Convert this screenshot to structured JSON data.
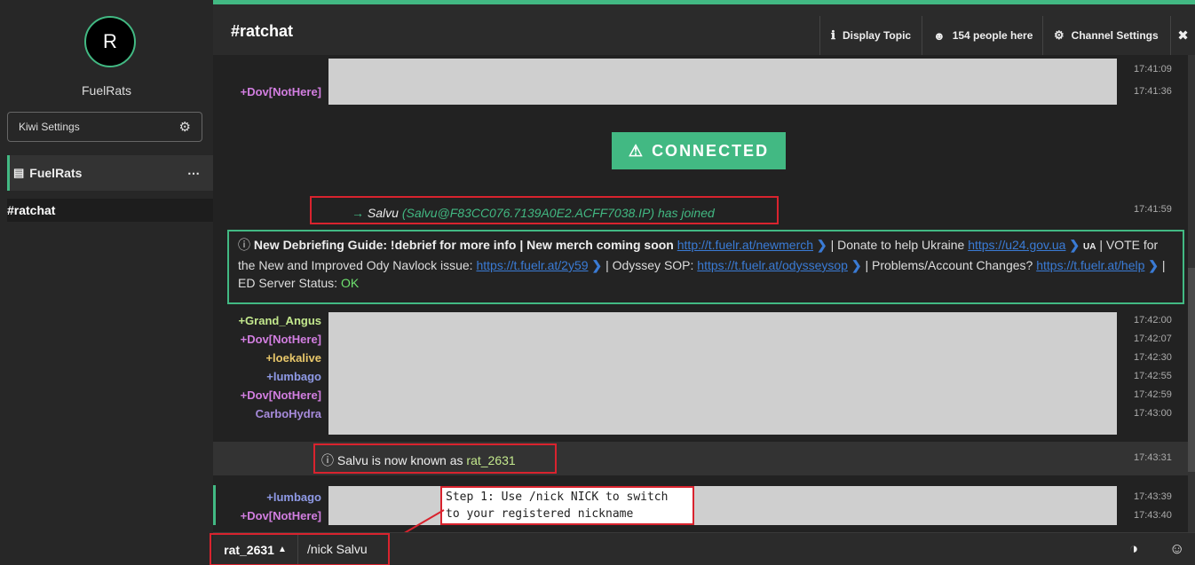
{
  "sidebar": {
    "avatar_letter": "R",
    "network_name": "FuelRats",
    "kiwi_settings": "Kiwi Settings",
    "network_label": "FuelRats",
    "network_menu": "⋯",
    "channel": "#ratchat"
  },
  "header": {
    "channel": "#ratchat",
    "display_topic": "Display Topic",
    "people": "154 people here",
    "channel_settings": "Channel Settings",
    "close": "✖"
  },
  "messages": {
    "top_rows": [
      {
        "nick": "",
        "time": "17:41:09"
      },
      {
        "nick": "+Dov[NotHere]",
        "time": "17:41:36"
      }
    ],
    "connected": "CONNECTED",
    "joined": {
      "arrow": "→",
      "nick": "Salvu",
      "host": "(Salvu@F83CC076.7139A0E2.ACFF7038.IP)",
      "action": "has joined",
      "time": "17:41:59"
    },
    "topic": {
      "bold": "New Debriefing Guide: !debrief for more info | New merch coming soon",
      "link1": "http://t.fuelr.at/newmerch",
      "t1": "| Donate to help Ukraine",
      "link2": "https://u24.gov.ua",
      "ua": "UA",
      "t2": "| VOTE for the New and Improved Ody Navlock issue:",
      "link3": "https://t.fuelr.at/2y59",
      "t3": "| Odyssey SOP:",
      "link4": "https://t.fuelr.at/odysseysop",
      "t4": "| Problems/Account Changes?",
      "link5": "https://t.fuelr.at/help",
      "t5": "| ED Server Status:",
      "status": "OK"
    },
    "rows": [
      {
        "nick": "+Grand_Angus",
        "time": "17:42:00",
        "color": "#c3e88d"
      },
      {
        "nick": "+Dov[NotHere]",
        "time": "17:42:07",
        "color": "#d27ee0"
      },
      {
        "nick": "+loekalive",
        "time": "17:42:30",
        "color": "#e8c76a"
      },
      {
        "nick": "+lumbago",
        "time": "17:42:55",
        "color": "#8f9ae6"
      },
      {
        "nick": "+Dov[NotHere]",
        "time": "17:42:59",
        "color": "#d27ee0"
      },
      {
        "nick": "CarboHydra",
        "time": "17:43:00",
        "color": "#a78bdc"
      }
    ],
    "nick_change": {
      "text": "Salvu is now known as",
      "new_nick": "rat_2631",
      "time": "17:43:31"
    },
    "bottom_rows": [
      {
        "nick": "+lumbago",
        "time": "17:43:39",
        "color": "#8f9ae6"
      },
      {
        "nick": "+Dov[NotHere]",
        "time": "17:43:40",
        "color": "#d27ee0"
      }
    ],
    "callout": {
      "line1": "Step 1: Use /nick NICK to switch",
      "line2": "to your registered nickname"
    }
  },
  "inputbar": {
    "current_nick": "rat_2631",
    "caret": "▲",
    "input_value": "/nick Salvu"
  },
  "colors": {
    "accent": "#42b983",
    "annotation_red": "#d9232e"
  }
}
